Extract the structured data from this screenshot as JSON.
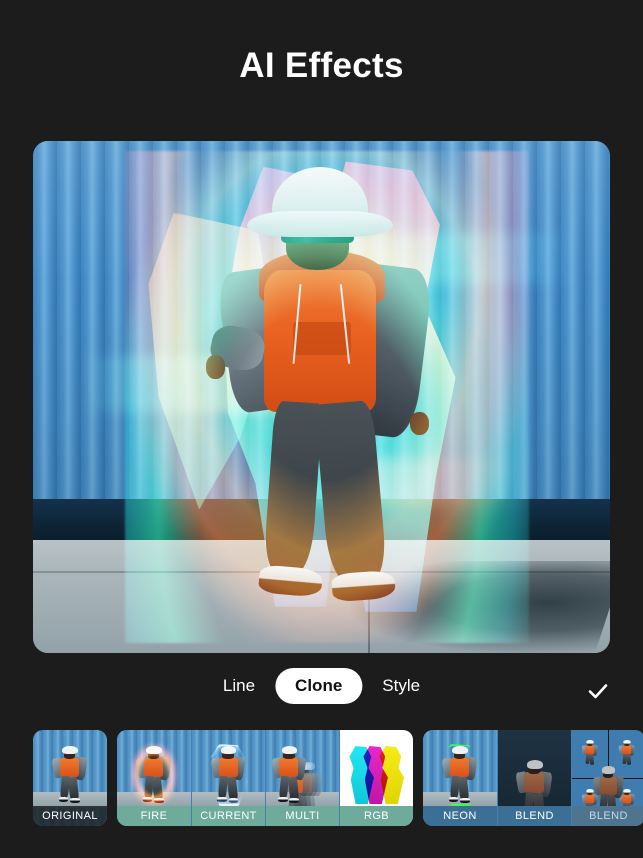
{
  "app": {
    "title": "AI Effects",
    "background_color": "#1c1c1c"
  },
  "preview": {
    "name": "effect-preview-image",
    "description": "Person in orange hoodie and white bucket hat walking past a blue corrugated metal wall, with rainbow thermal clone trails applied"
  },
  "tabbar": {
    "tabs": [
      {
        "label": "Line",
        "active": false
      },
      {
        "label": "Clone",
        "active": true
      },
      {
        "label": "Style",
        "active": false
      }
    ],
    "confirm_icon": "checkmark-icon",
    "active_tab_bg": "#ffffff",
    "active_tab_fg": "#111111"
  },
  "thumbnails": {
    "groups": [
      {
        "name": "original-group",
        "items": [
          {
            "label": "ORIGINAL",
            "style": "dark",
            "effect": "original",
            "selected": false
          }
        ]
      },
      {
        "name": "clone-effects-group",
        "items": [
          {
            "label": "FIRE",
            "style": "green",
            "effect": "fire",
            "selected": false
          },
          {
            "label": "CURRENT",
            "style": "green",
            "effect": "current",
            "selected": false
          },
          {
            "label": "MULTI",
            "style": "green",
            "effect": "multi",
            "selected": false
          },
          {
            "label": "RGB",
            "style": "green",
            "effect": "rgb",
            "selected": false
          }
        ]
      },
      {
        "name": "blend-effects-group",
        "items": [
          {
            "label": "NEON",
            "style": "blue",
            "effect": "neon",
            "selected": false
          },
          {
            "label": "BLEND",
            "style": "blue",
            "effect": "blend",
            "selected": false
          },
          {
            "label": "BLEND",
            "style": "muted",
            "effect": "blend-tile",
            "selected": false
          }
        ]
      }
    ],
    "label_colors": {
      "green": "#6fab9b",
      "blue": "#3c6f96",
      "muted": "#4e7490",
      "dark": "#1c1c1c"
    }
  }
}
